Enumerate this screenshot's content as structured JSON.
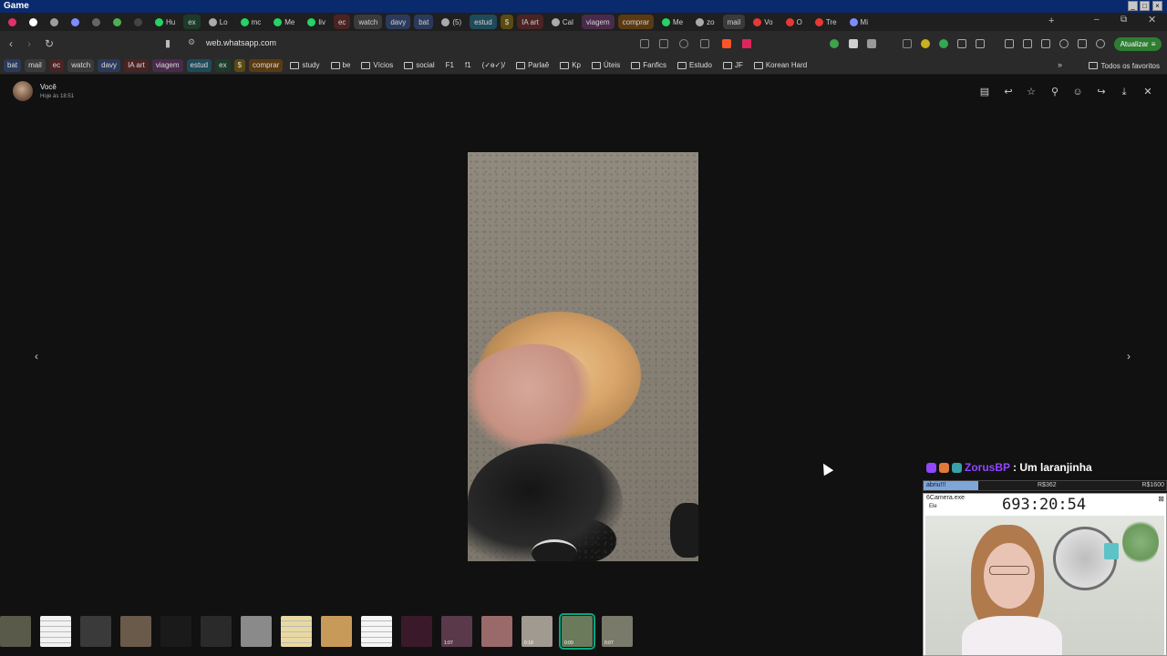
{
  "window": {
    "title": "Game"
  },
  "tabs": [
    {
      "label": "",
      "color": "#e1306c"
    },
    {
      "label": "",
      "color": "#ffffff"
    },
    {
      "label": "",
      "color": "#9e9e9e"
    },
    {
      "label": "",
      "color": "#7d8cff"
    },
    {
      "label": "",
      "color": "#666666"
    },
    {
      "label": "",
      "color": "#4caf50"
    },
    {
      "label": "",
      "color": "#444444"
    },
    {
      "label": "Hu",
      "color": "#25d366"
    },
    {
      "label": "ex",
      "color": "",
      "bg": "#1d3b2a"
    },
    {
      "label": "Lo",
      "color": "#aaaaaa"
    },
    {
      "label": "mc",
      "color": "#25d366"
    },
    {
      "label": "Me",
      "color": "#25d366"
    },
    {
      "label": "liv",
      "color": "#25d366"
    },
    {
      "label": "ec",
      "color": "",
      "bg": "#4a2323"
    },
    {
      "label": "watch",
      "color": "",
      "bg": "#3a3a3a"
    },
    {
      "label": "davy",
      "color": "",
      "bg": "#2b3a5a"
    },
    {
      "label": "bat",
      "color": "",
      "bg": "#2b3a5a"
    },
    {
      "label": "(5)",
      "color": "#aaaaaa"
    },
    {
      "label": "estud",
      "color": "",
      "bg": "#1f4a5a"
    },
    {
      "label": "$",
      "color": "",
      "bg": "#5a4a12"
    },
    {
      "label": "IA art",
      "color": "",
      "bg": "#4a2323"
    },
    {
      "label": "Cal",
      "color": "#aaaaaa"
    },
    {
      "label": "viagem",
      "color": "",
      "bg": "#4a2a4a"
    },
    {
      "label": "comprar",
      "color": "",
      "bg": "#5a3a12"
    },
    {
      "label": "Me",
      "color": "#25d366"
    },
    {
      "label": "zo",
      "color": "#aaaaaa"
    },
    {
      "label": "mail",
      "color": "",
      "bg": "#3a3a3a"
    },
    {
      "label": "Vo",
      "color": "#e53935"
    },
    {
      "label": "O",
      "color": "#e53935"
    },
    {
      "label": "Tre",
      "color": "#e53935"
    },
    {
      "label": "Mi",
      "color": "#7d8cff"
    }
  ],
  "address": {
    "url": "web.whatsapp.com",
    "update_label": "Atualizar"
  },
  "bookmarks": [
    {
      "label": "bat",
      "kind": "chip",
      "bg": "#2b3a5a"
    },
    {
      "label": "mail",
      "kind": "chip",
      "bg": "#3a3a3a"
    },
    {
      "label": "ec",
      "kind": "chip",
      "bg": "#4a2323"
    },
    {
      "label": "watch",
      "kind": "chip",
      "bg": "#3a3a3a"
    },
    {
      "label": "davy",
      "kind": "chip",
      "bg": "#2b3a5a"
    },
    {
      "label": "IA art",
      "kind": "chip",
      "bg": "#4a2323"
    },
    {
      "label": "viagem",
      "kind": "chip",
      "bg": "#4a2a4a"
    },
    {
      "label": "estud",
      "kind": "chip",
      "bg": "#1f4a5a"
    },
    {
      "label": "ex",
      "kind": "chip",
      "bg": "#1d3b2a"
    },
    {
      "label": "$",
      "kind": "chip",
      "bg": "#5a4a12"
    },
    {
      "label": "comprar",
      "kind": "chip",
      "bg": "#5a3a12"
    },
    {
      "label": "study",
      "kind": "folder"
    },
    {
      "label": "be",
      "kind": "folder"
    },
    {
      "label": "Vícios",
      "kind": "folder"
    },
    {
      "label": "social",
      "kind": "folder"
    },
    {
      "label": "F1",
      "kind": "plain"
    },
    {
      "label": "f1",
      "kind": "plain"
    },
    {
      "label": "(✓ɵ✓)/",
      "kind": "plain"
    },
    {
      "label": "Parlaê",
      "kind": "folder"
    },
    {
      "label": "Kp",
      "kind": "folder"
    },
    {
      "label": "Úteis",
      "kind": "folder"
    },
    {
      "label": "Fanfics",
      "kind": "folder"
    },
    {
      "label": "Estudo",
      "kind": "folder"
    },
    {
      "label": "JF",
      "kind": "folder"
    },
    {
      "label": "Korean Hard",
      "kind": "folder"
    }
  ],
  "all_bookmarks_label": "Todos os favoritos",
  "viewer": {
    "sender": "Você",
    "timestamp": "Hoje às 18:51",
    "icons": [
      "grid-icon",
      "reply-icon",
      "star-icon",
      "pin-icon",
      "emoji-icon",
      "forward-icon",
      "download-icon",
      "close-icon"
    ]
  },
  "thumbnails": [
    {
      "kind": "photo",
      "bg": "#5a5a4a",
      "duration": ""
    },
    {
      "kind": "doc",
      "bg": "#f2f2f2",
      "duration": ""
    },
    {
      "kind": "photo",
      "bg": "#3a3a3a",
      "duration": ""
    },
    {
      "kind": "photo",
      "bg": "#6a5a4a",
      "duration": ""
    },
    {
      "kind": "photo",
      "bg": "#1a1a1a",
      "duration": ""
    },
    {
      "kind": "photo",
      "bg": "#2a2a2a",
      "duration": ""
    },
    {
      "kind": "photo",
      "bg": "#8a8a8a",
      "duration": ""
    },
    {
      "kind": "doc",
      "bg": "#e9d9a0",
      "duration": ""
    },
    {
      "kind": "photo",
      "bg": "#c89a5a",
      "duration": ""
    },
    {
      "kind": "doc",
      "bg": "#f5f5f5",
      "duration": ""
    },
    {
      "kind": "photo",
      "bg": "#3a1a2a",
      "duration": ""
    },
    {
      "kind": "video",
      "bg": "#5a3a4a",
      "duration": "1:07"
    },
    {
      "kind": "photo",
      "bg": "#9a6a6a",
      "duration": ""
    },
    {
      "kind": "video",
      "bg": "#a09a90",
      "duration": "0:18"
    },
    {
      "kind": "video",
      "bg": "#6a7a5a",
      "duration": "0:09",
      "selected": true
    },
    {
      "kind": "video",
      "bg": "#7a7a6a",
      "duration": "0:07"
    }
  ],
  "overlay": {
    "chat_user": "ZorusBP",
    "chat_message": ": Um laranjinha",
    "goal_label": "abriu!!!",
    "goal_current": "R$362",
    "goal_max": "R$1600",
    "goal_fraction": 0.226,
    "cam_title": "6Camera.exe",
    "cam_menu": "Ele",
    "timer": "693:20:54"
  },
  "colors": {
    "accent": "#00a884",
    "twitch": "#9146ff"
  }
}
